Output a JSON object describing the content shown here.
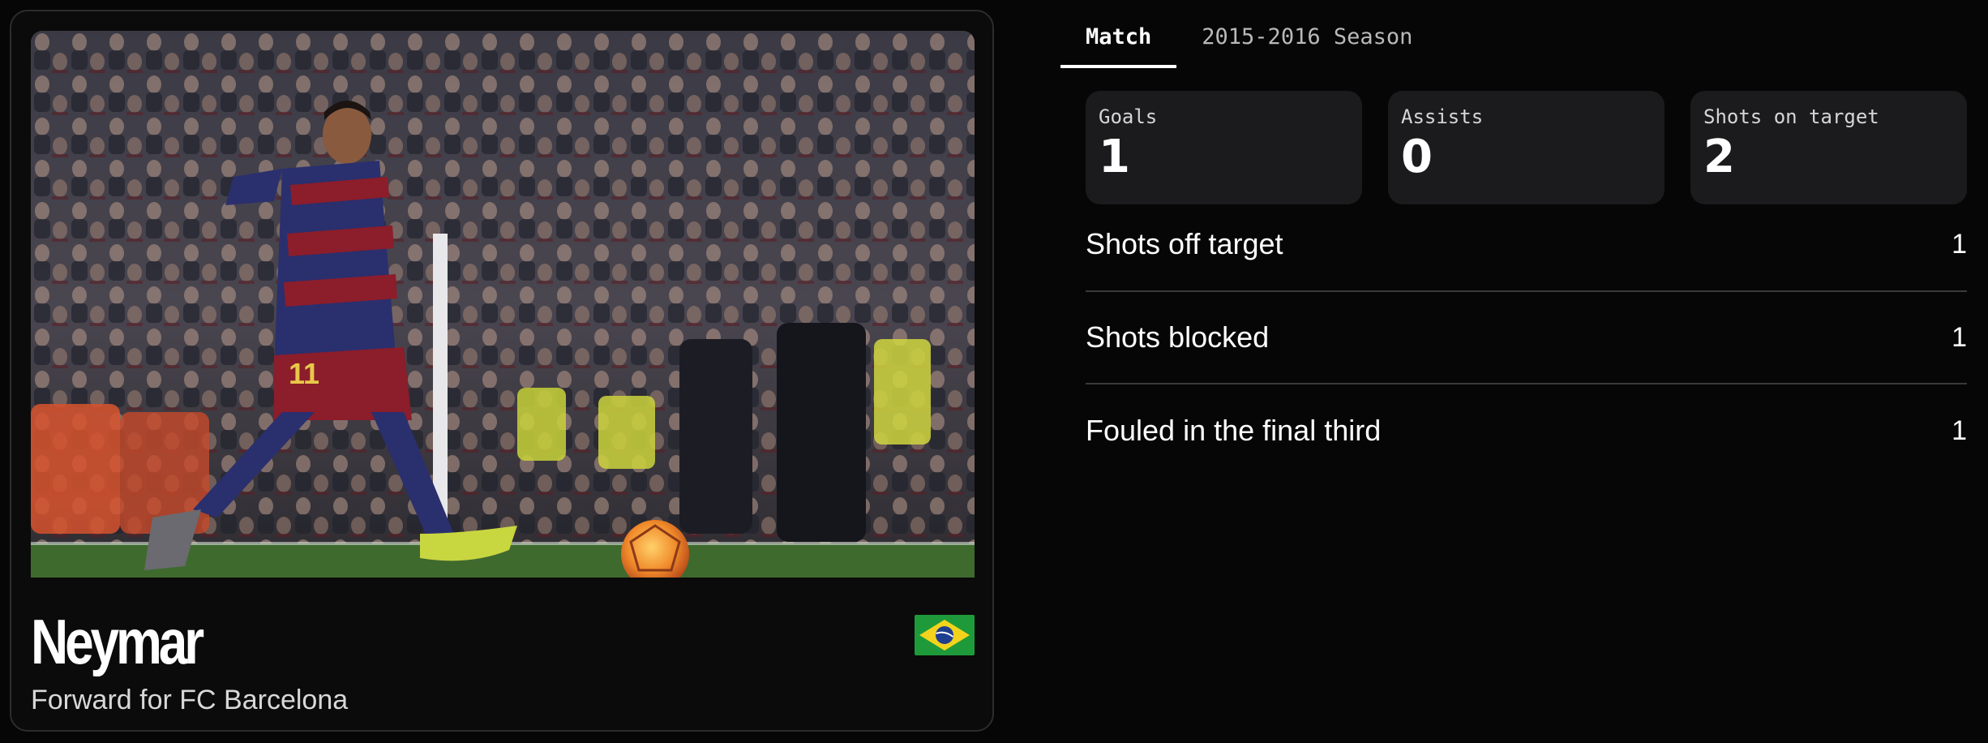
{
  "player": {
    "name": "Neymar",
    "role": "Forward for FC Barcelona",
    "flag_icon": "brazil-flag-icon",
    "photo_description_icon": "player-photo"
  },
  "tabs": [
    {
      "label": "Match",
      "active": true
    },
    {
      "label": "2015-2016 Season",
      "active": false
    }
  ],
  "stat_cards": [
    {
      "label": "Goals",
      "value": "1"
    },
    {
      "label": "Assists",
      "value": "0"
    },
    {
      "label": "Shots on target",
      "value": "2"
    }
  ],
  "stat_rows": [
    {
      "label": "Shots off target",
      "value": "1"
    },
    {
      "label": "Shots blocked",
      "value": "1"
    },
    {
      "label": "Fouled in the final third",
      "value": "1"
    }
  ],
  "colors": {
    "background": "#060606",
    "card_surface": "#1b1b1d",
    "accent": "#ffffff"
  }
}
